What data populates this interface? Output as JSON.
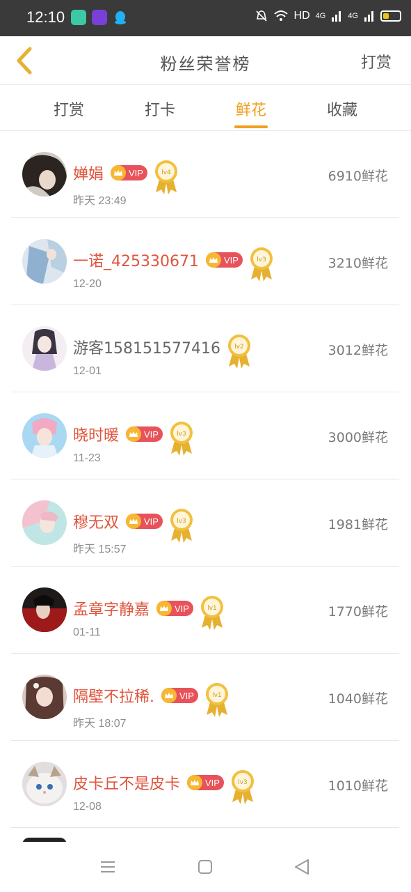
{
  "status_bar": {
    "time": "12:10",
    "network": "HD",
    "signal1": "4G",
    "signal2": "4G"
  },
  "header": {
    "back_icon": "chevron-left-icon",
    "title": "粉丝荣誉榜",
    "action_label": "打赏"
  },
  "tabs": [
    {
      "label": "打赏",
      "active": false
    },
    {
      "label": "打卡",
      "active": false
    },
    {
      "label": "鲜花",
      "active": true
    },
    {
      "label": "收藏",
      "active": false
    }
  ],
  "colors": {
    "accent": "#f0a020",
    "name_red": "#e0543c",
    "vip_red": "#e8525a",
    "medal_gold": "#e6b030"
  },
  "rows": [
    {
      "name": "婵娟",
      "vip": "VIP",
      "level": "lv4",
      "date": "昨天 23:49",
      "value": "6910鲜花"
    },
    {
      "name": "一诺_425330671",
      "vip": "VIP",
      "level": "lv3",
      "date": "12-20",
      "value": "3210鲜花"
    },
    {
      "name": "游客158151577416",
      "vip": "",
      "level": "lv2",
      "date": "12-01",
      "value": "3012鲜花"
    },
    {
      "name": "晓时暖",
      "vip": "VIP",
      "level": "lv3",
      "date": "11-23",
      "value": "3000鲜花"
    },
    {
      "name": "穆无双",
      "vip": "VIP",
      "level": "lv3",
      "date": "昨天 15:57",
      "value": "1981鲜花"
    },
    {
      "name": "孟章字静嘉",
      "vip": "VIP",
      "level": "lv1",
      "date": "01-11",
      "value": "1770鲜花"
    },
    {
      "name": "隔壁不拉稀.",
      "vip": "VIP",
      "level": "lv1",
      "date": "昨天 18:07",
      "value": "1040鲜花"
    },
    {
      "name": "皮卡丘不是皮卡",
      "vip": "VIP",
      "level": "lv3",
      "date": "12-08",
      "value": "1010鲜花"
    }
  ],
  "nav": {
    "menu_icon": "menu-icon",
    "home_icon": "home-square-icon",
    "back_icon": "back-triangle-icon"
  }
}
